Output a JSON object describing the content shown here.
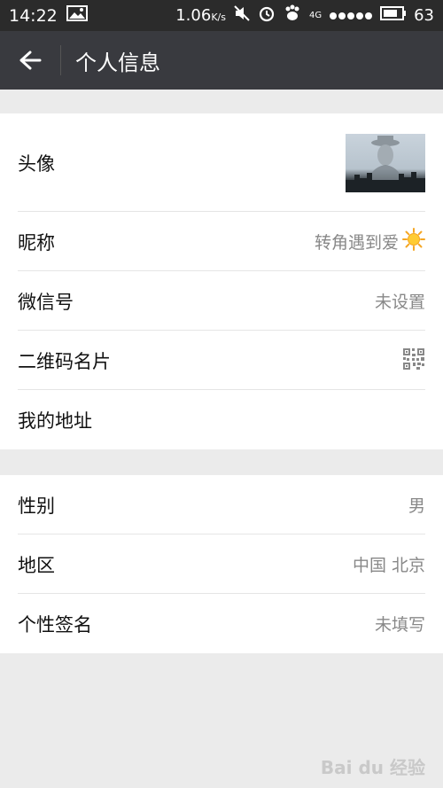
{
  "status_bar": {
    "time": "14:22",
    "speed": "1.06",
    "speed_unit": "K/s",
    "network": "4G",
    "battery": "63"
  },
  "nav": {
    "title": "个人信息"
  },
  "profile_group": {
    "rows": [
      {
        "label": "头像"
      },
      {
        "label": "昵称",
        "value": "转角遇到爱"
      },
      {
        "label": "微信号",
        "value": "未设置"
      },
      {
        "label": "二维码名片"
      },
      {
        "label": "我的地址"
      }
    ]
  },
  "detail_group": {
    "rows": [
      {
        "label": "性别",
        "value": "男"
      },
      {
        "label": "地区",
        "value": "中国 北京"
      },
      {
        "label": "个性签名",
        "value": "未填写"
      }
    ]
  },
  "watermark": "Bai du 经验",
  "icons": {
    "back": "arrow-left-icon",
    "sun": "sun-emoji-icon",
    "qr": "qr-code-icon"
  }
}
